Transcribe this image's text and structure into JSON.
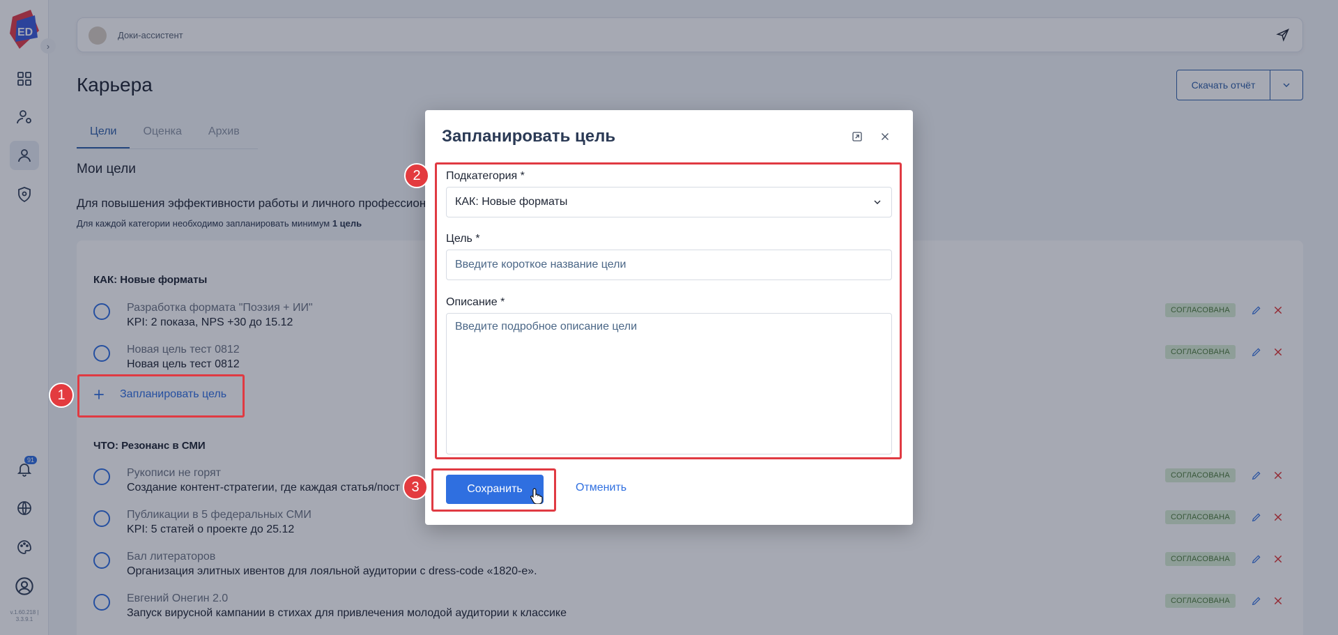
{
  "sidebar": {
    "logo_text": "ED",
    "bell_count": "91",
    "version": "v.1.60.218 | 3.3.9.1",
    "icons": [
      "dashboard-icon",
      "user-settings-icon",
      "user-icon",
      "shield-icon",
      "bell-icon",
      "globe-icon",
      "palette-icon",
      "account-circle-icon"
    ]
  },
  "assistant": {
    "label": "Доки-ассистент"
  },
  "page": {
    "title": "Карьера",
    "report_button": "Скачать отчёт",
    "tabs": [
      "Цели",
      "Оценка",
      "Архив"
    ],
    "section_title": "Мои цели",
    "intro": "Для повышения эффективности работы и личного профессион",
    "note_prefix": "Для каждой категории необходимо запланировать минимум ",
    "note_bold": "1 цель"
  },
  "goals": {
    "categories": [
      {
        "label": "КАК: Новые форматы",
        "items": [
          {
            "title": "Разработка формата \"Поэзия + ИИ\"",
            "desc": "KPI: 2 показа, NPS +30 до 15.12",
            "status": "СОГЛАСОВАНА"
          },
          {
            "title": "Новая цель тест 0812",
            "desc": "Новая цель тест 0812",
            "status": "СОГЛАСОВАНА"
          }
        ],
        "plan_label": "Запланировать цель"
      },
      {
        "label": "ЧТО: Резонанс в СМИ",
        "items": [
          {
            "title": "Рукописи не горят",
            "desc": "Создание контент-стратегии, где каждая статья/пост",
            "status": "СОГЛАСОВАНА"
          },
          {
            "title": "Публикации в 5 федеральных СМИ",
            "desc": "KPI: 5 статей о проекте до 25.12",
            "status": "СОГЛАСОВАНА"
          },
          {
            "title": "Бал литераторов",
            "desc": "Организация элитных ивентов для лояльной аудитории с dress-code «1820-е».",
            "status": "СОГЛАСОВАНА"
          },
          {
            "title": "Евгений Онегин 2.0",
            "desc": "Запуск вирусной кампании в стихах для привлечения молодой аудитории к классике",
            "status": "СОГЛАСОВАНА"
          }
        ]
      }
    ]
  },
  "modal": {
    "title": "Запланировать цель",
    "subcategory_label": "Подкатегория *",
    "subcategory_value": "КАК: Новые форматы",
    "goal_label": "Цель *",
    "goal_placeholder": "Введите короткое название цели",
    "description_label": "Описание *",
    "description_placeholder": "Введите подробное описание цели",
    "save_label": "Сохранить",
    "cancel_label": "Отменить"
  },
  "annotations": {
    "steps": [
      "1",
      "2",
      "3"
    ],
    "color": "#e03a42"
  },
  "colors": {
    "accent": "#2f6fe0",
    "status_bg": "#d9eed3",
    "status_text": "#4c7a3b",
    "danger": "#e03030"
  }
}
